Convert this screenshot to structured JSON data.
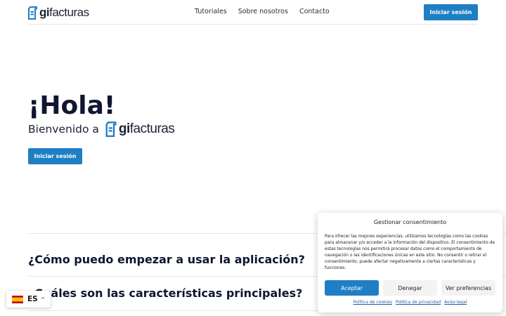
{
  "brand": {
    "name_bold": "gi",
    "name_rest": "facturas",
    "color": "#1f7fc4"
  },
  "nav": {
    "items": [
      "Tutoriales",
      "Sobre nosotros",
      "Contacto"
    ]
  },
  "header": {
    "login_label": "Iniciar sesión"
  },
  "hero": {
    "title": "¡Hola!",
    "subtitle": "Bienvenido a",
    "login_label": "Iniciar sesión"
  },
  "faq": {
    "questions": [
      "¿Cómo puedo empezar a usar la aplicación?",
      "¿Cuáles son las características principales?"
    ]
  },
  "language": {
    "code": "ES",
    "flag": "spain-flag-icon",
    "caret": "^"
  },
  "consent": {
    "title": "Gestionar consentimiento",
    "text": "Para ofrecer las mejores experiencias, utilizamos tecnologías como las cookies para almacenar y/o acceder a la información del dispositivo. El consentimiento de estas tecnologías nos permitirá procesar datos como el comportamiento de navegación o las identificaciones únicas en este sitio. No consentir o retirar el consentimiento, puede afectar negativamente a ciertas características y funciones.",
    "accept": "Aceptar",
    "deny": "Denegar",
    "preferences": "Ver preferencias",
    "links": [
      "Política de cookies",
      "Política de privacidad",
      "Aviso legal"
    ]
  },
  "colors": {
    "primary": "#1f7fc4",
    "heading": "#0f1630"
  }
}
